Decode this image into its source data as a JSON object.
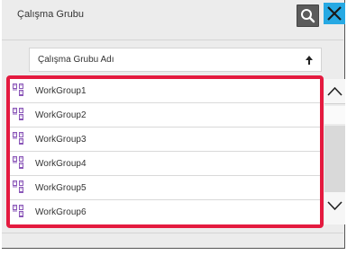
{
  "header": {
    "title": "Çalışma Grubu",
    "search_icon": "search-icon",
    "close_icon": "close-icon",
    "accent": "#27a9e3"
  },
  "sort": {
    "label": "Çalışma Grubu Adı",
    "direction_icon": "arrow-up-icon"
  },
  "list": {
    "items": [
      {
        "label": "WorkGroup1",
        "icon": "workgroup-icon"
      },
      {
        "label": "WorkGroup2",
        "icon": "workgroup-icon"
      },
      {
        "label": "WorkGroup3",
        "icon": "workgroup-icon"
      },
      {
        "label": "WorkGroup4",
        "icon": "workgroup-icon"
      },
      {
        "label": "WorkGroup5",
        "icon": "workgroup-icon"
      },
      {
        "label": "WorkGroup6",
        "icon": "workgroup-icon"
      }
    ],
    "highlight_color": "#e41a3f"
  },
  "scrollbar": {
    "up_icon": "chevron-up-icon",
    "down_icon": "chevron-down-icon"
  }
}
